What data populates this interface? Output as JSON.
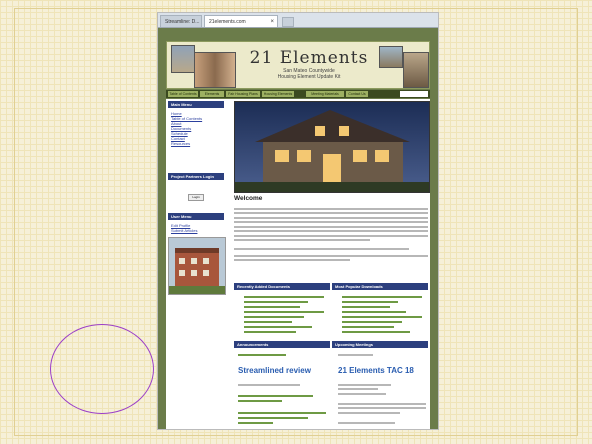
{
  "browser": {
    "tab1_label": "Streamline: D...",
    "tab2_label": "21elements.com"
  },
  "site": {
    "title": "21 Elements",
    "subtitle_1": "San Mateo Countywide",
    "subtitle_2": "Housing Element Update Kit"
  },
  "nav": [
    "Table of Contents",
    "Elements",
    "Fair Housing Plans",
    "Housing Elements",
    "Meeting Materials",
    "Contact Us"
  ],
  "sidebar": {
    "main_menu_title": "Main Menu",
    "main_menu_items": [
      "Home",
      "Table of Contents",
      "About",
      "Documents",
      "Schedule",
      "Contact",
      "Resources"
    ],
    "partners_title": "Project Partners Login",
    "login_button": "Login",
    "user_menu_title": "User Menu",
    "user_menu_items": [
      "Edit Profile",
      "Submit Articles"
    ]
  },
  "main": {
    "welcome": "Welcome",
    "recent_docs_title": "Recently Added Documents",
    "popular_title": "Most Popular Downloads",
    "announcements_title": "Announcements",
    "announcement_headline": "Streamlined review",
    "meetings_title": "Upcoming Meetings",
    "meeting_headline": "21 Elements TAC 18"
  },
  "colors": {
    "annotation_circle": "#9b3ec8",
    "header_blue": "#2c3f7e",
    "site_olive": "#6b7c4a"
  }
}
